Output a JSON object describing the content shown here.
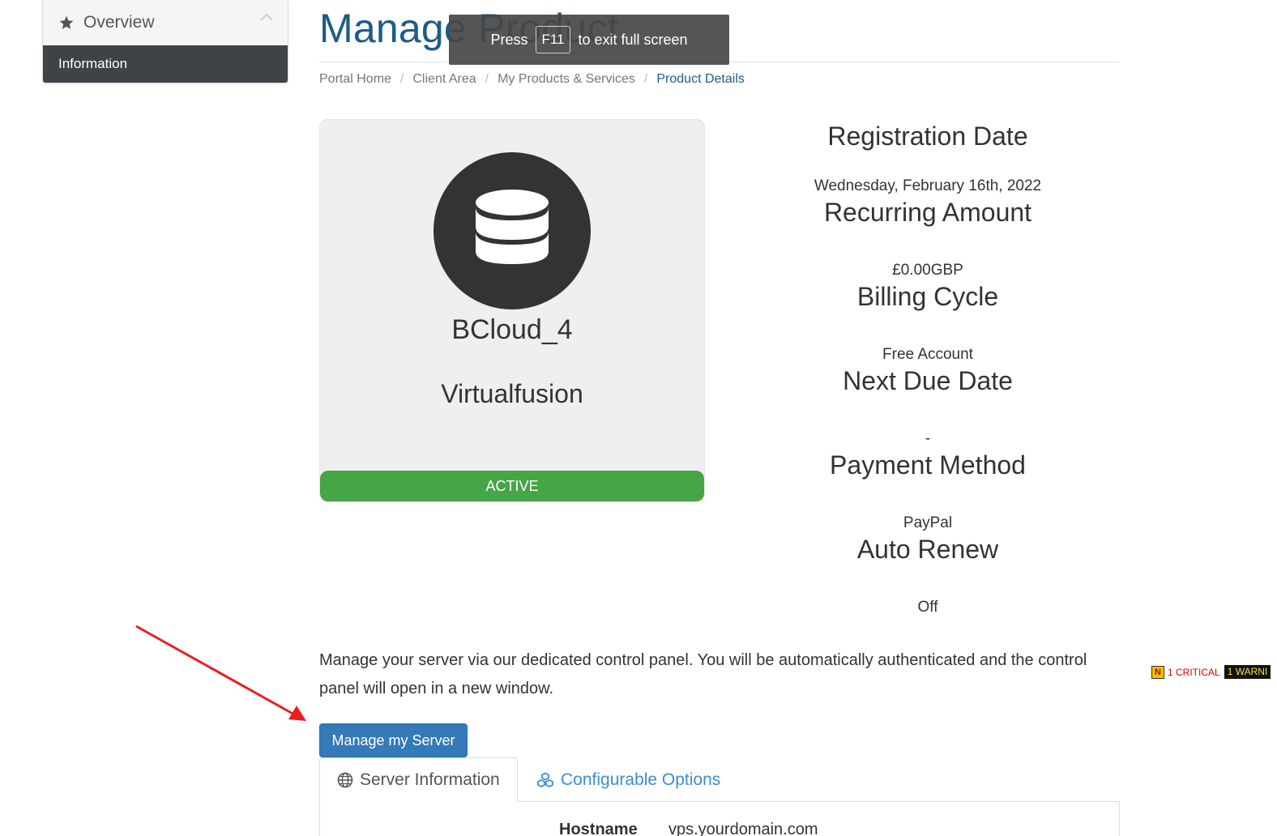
{
  "sidebar": {
    "header_label": "Overview",
    "active_item": "Information"
  },
  "header": {
    "title": "Manage Product"
  },
  "fullscreen_notice": {
    "prefix": "Press",
    "key": "F11",
    "suffix": "to exit full screen"
  },
  "breadcrumb": [
    "Portal Home",
    "Client Area",
    "My Products & Services",
    "Product Details"
  ],
  "product": {
    "icon": "database-icon",
    "name": "BCloud_4",
    "group": "Virtualfusion",
    "status": "ACTIVE",
    "status_color": "#46a546"
  },
  "details": [
    {
      "label": "Registration Date",
      "value": "Wednesday, February 16th, 2022"
    },
    {
      "label": "Recurring Amount",
      "value": "£0.00GBP"
    },
    {
      "label": "Billing Cycle",
      "value": "Free Account"
    },
    {
      "label": "Next Due Date",
      "value": "-"
    },
    {
      "label": "Payment Method",
      "value": "PayPal"
    },
    {
      "label": "Auto Renew",
      "value": "Off"
    }
  ],
  "manage": {
    "description": "Manage your server via our dedicated control panel. You will be automatically authenticated and the control panel will open in a new window.",
    "button_label": "Manage my Server"
  },
  "tabs": [
    {
      "label": "Server Information",
      "icon": "globe-icon"
    },
    {
      "label": "Configurable Options",
      "icon": "cubes-icon"
    }
  ],
  "server_info": {
    "hostname_label": "Hostname",
    "hostname_value": "vps.yourdomain.com"
  },
  "debug_badge": {
    "critical": "1 CRITICAL",
    "warning": "1 WARNI"
  },
  "colors": {
    "title": "#1c5c88",
    "button": "#337ab7",
    "link": "#3c8dd0",
    "sidebar_active": "#3f4347",
    "annotation_arrow": "#e8201c"
  }
}
